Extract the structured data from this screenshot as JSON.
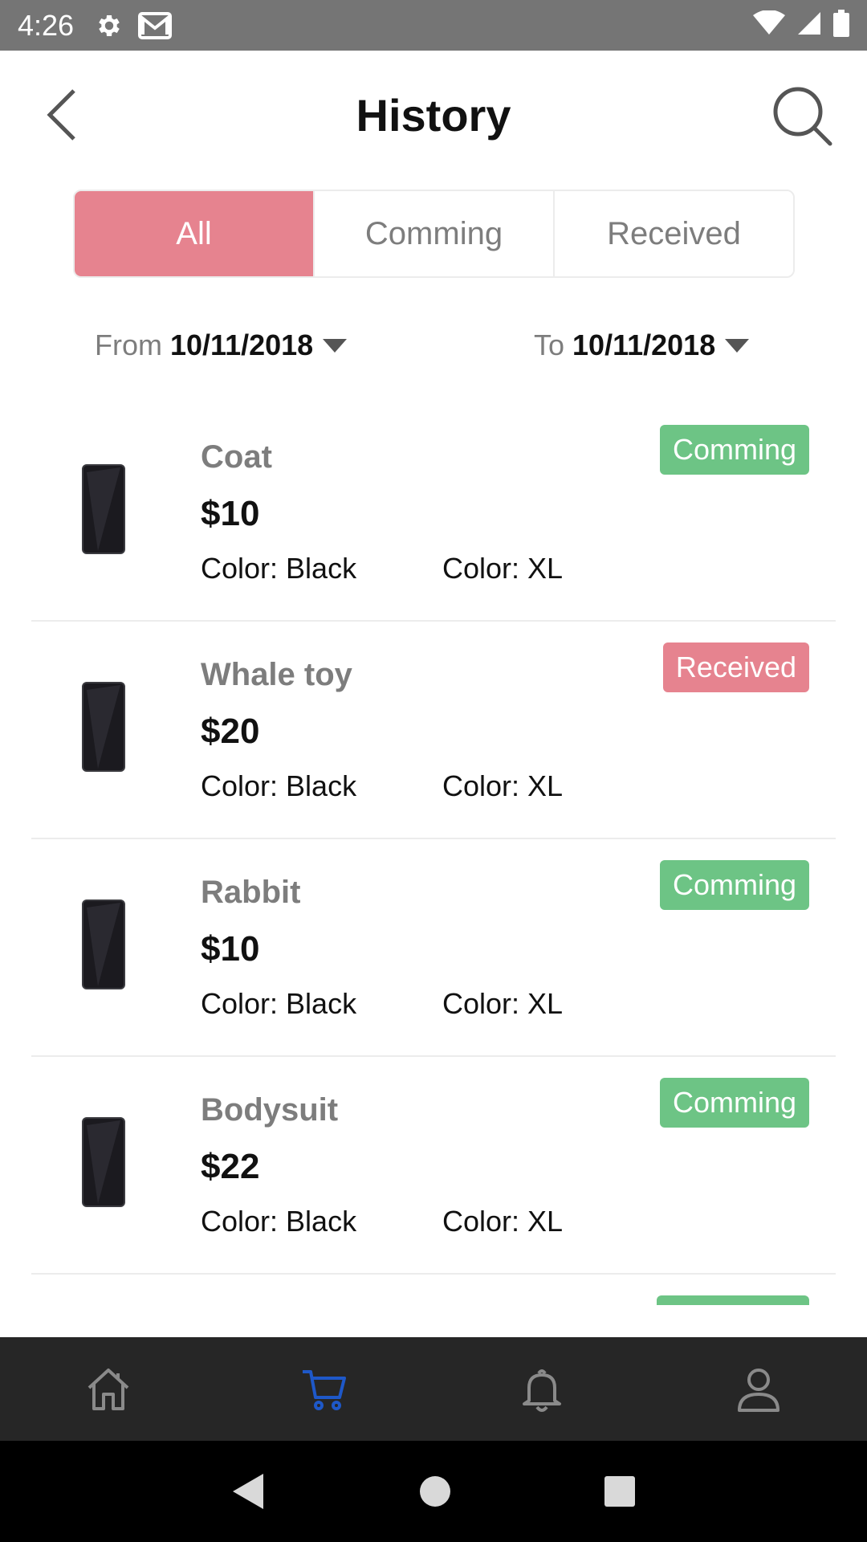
{
  "status_bar": {
    "time": "4:26"
  },
  "header": {
    "title": "History"
  },
  "tabs": [
    {
      "label": "All",
      "active": true
    },
    {
      "label": "Comming",
      "active": false
    },
    {
      "label": "Received",
      "active": false
    }
  ],
  "filter": {
    "from_label": "From",
    "from_date": "10/11/2018",
    "to_label": "To",
    "to_date": "10/11/2018"
  },
  "orders": [
    {
      "name": "Coat",
      "price": "$10",
      "color": "Color: Black",
      "size": "Color: XL",
      "status": "Comming"
    },
    {
      "name": "Whale toy",
      "price": "$20",
      "color": "Color: Black",
      "size": "Color: XL",
      "status": "Received"
    },
    {
      "name": "Rabbit",
      "price": "$10",
      "color": "Color: Black",
      "size": "Color: XL",
      "status": "Comming"
    },
    {
      "name": "Bodysuit",
      "price": "$22",
      "color": "Color: Black",
      "size": "Color: XL",
      "status": "Comming"
    }
  ],
  "colors": {
    "accent_pink": "#e6838f",
    "status_green": "#6dc485",
    "nav_active": "#1e58c8",
    "nav_inactive": "#8a8a8a"
  },
  "bottom_nav": [
    {
      "icon": "home-icon",
      "active": false
    },
    {
      "icon": "cart-icon",
      "active": true
    },
    {
      "icon": "bell-icon",
      "active": false
    },
    {
      "icon": "user-icon",
      "active": false
    }
  ]
}
